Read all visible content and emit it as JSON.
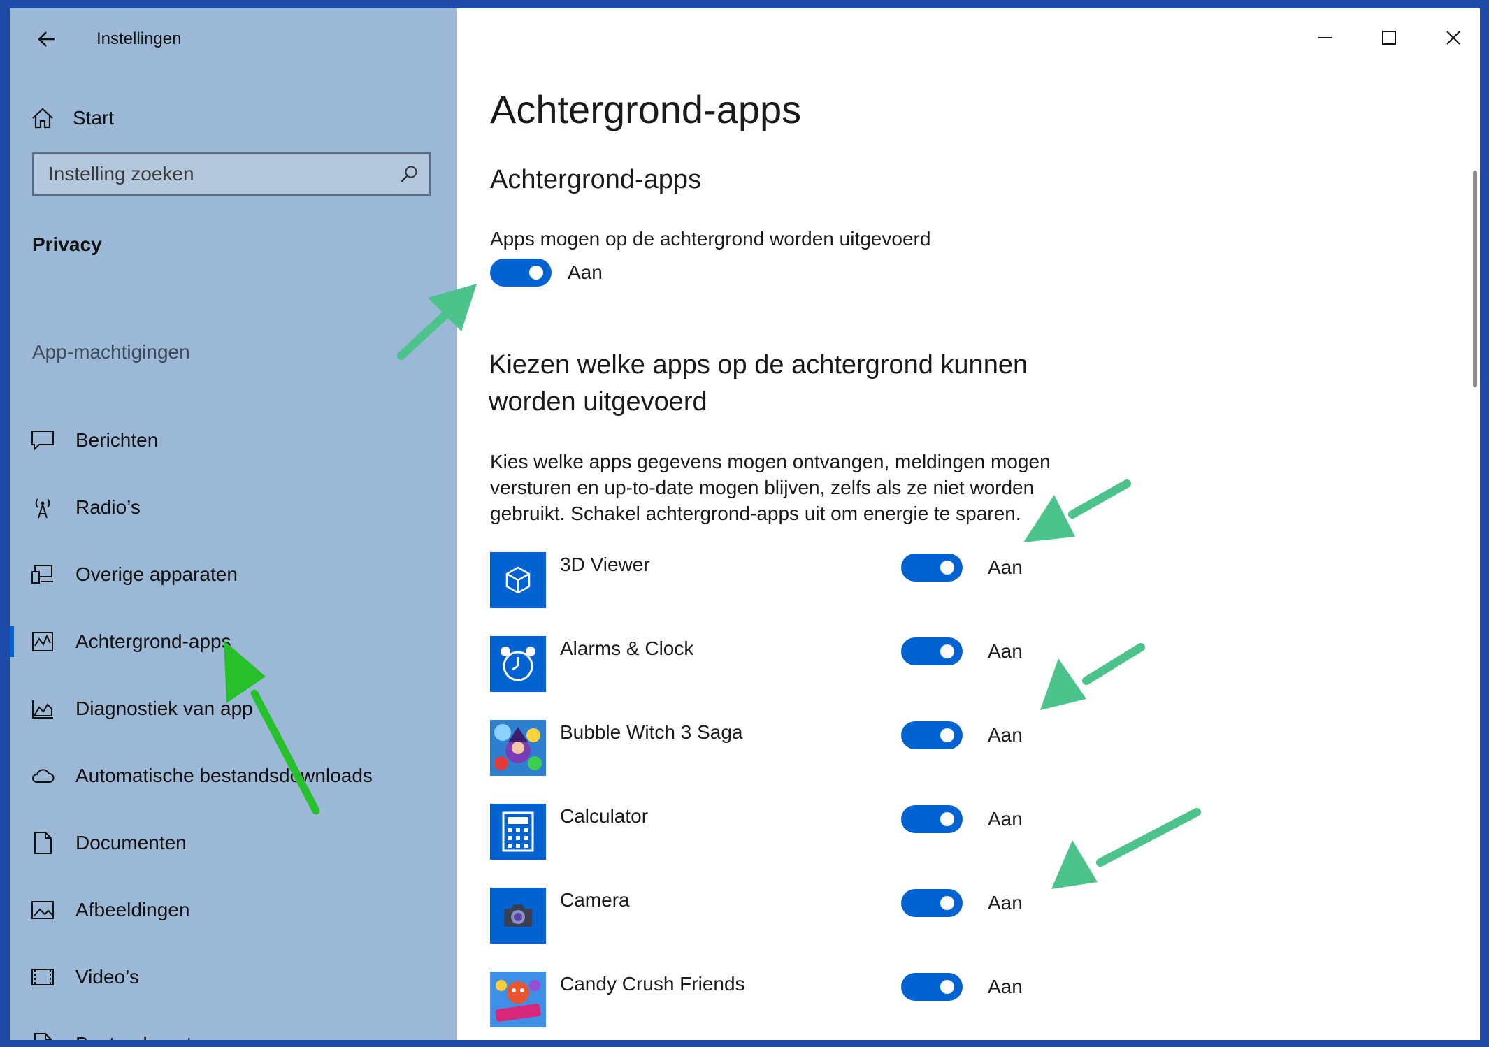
{
  "window": {
    "title": "Instellingen"
  },
  "sidebar": {
    "home_label": "Start",
    "search_placeholder": "Instelling zoeken",
    "section_title": "Privacy",
    "group_label": "App-machtigingen",
    "items": [
      {
        "label": "Berichten",
        "icon": "message-icon"
      },
      {
        "label": "Radio’s",
        "icon": "radio-antenna-icon"
      },
      {
        "label": "Overige apparaten",
        "icon": "devices-icon"
      },
      {
        "label": "Achtergrond-apps",
        "icon": "background-apps-icon",
        "active": true
      },
      {
        "label": "Diagnostiek van app",
        "icon": "diagnostics-icon"
      },
      {
        "label": "Automatische bestandsdownloads",
        "icon": "cloud-icon"
      },
      {
        "label": "Documenten",
        "icon": "document-icon"
      },
      {
        "label": "Afbeeldingen",
        "icon": "picture-icon"
      },
      {
        "label": "Video’s",
        "icon": "video-icon"
      },
      {
        "label": "Bestandssysteem",
        "icon": "file-system-icon"
      }
    ]
  },
  "main": {
    "page_title": "Achtergrond-apps",
    "section_title": "Achtergrond-apps",
    "master_toggle": {
      "caption": "Apps mogen op de achtergrond worden uitgevoerd",
      "state": "Aan"
    },
    "choose_heading": "Kiezen welke apps op de achtergrond kunnen worden uitgevoerd",
    "description": "Kies welke apps gegevens mogen ontvangen, meldingen mogen versturen en up-to-date mogen blijven, zelfs als ze niet worden gebruikt. Schakel achtergrond-apps uit om energie te sparen.",
    "apps": [
      {
        "name": "3D Viewer",
        "state": "Aan",
        "icon": "3d-viewer-icon"
      },
      {
        "name": "Alarms & Clock",
        "state": "Aan",
        "icon": "alarm-clock-icon"
      },
      {
        "name": "Bubble Witch 3 Saga",
        "state": "Aan",
        "icon": "bubble-witch-icon"
      },
      {
        "name": "Calculator",
        "state": "Aan",
        "icon": "calculator-icon"
      },
      {
        "name": "Camera",
        "state": "Aan",
        "icon": "camera-icon"
      },
      {
        "name": "Candy Crush Friends",
        "state": "Aan",
        "icon": "candy-crush-friends-icon"
      }
    ]
  },
  "colors": {
    "accent": "#0063d1",
    "sidebar_bg": "#9bb9d6",
    "annotation_green": "#4cc38a",
    "annotation_bright_green": "#27c02b",
    "frame": "#1e4aa8"
  }
}
